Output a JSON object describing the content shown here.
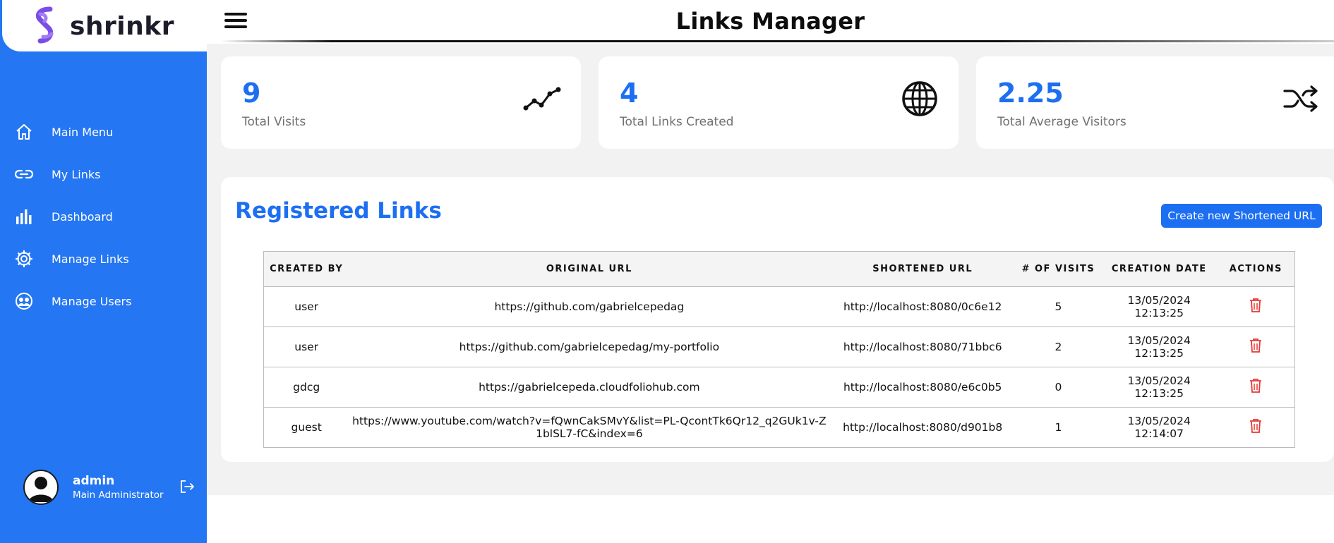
{
  "app": {
    "name": "shrinkr",
    "page_title": "Links Manager"
  },
  "colors": {
    "sidebar": "#2476f2",
    "accent": "#1d6ff2",
    "danger": "#e53935",
    "text_muted": "#707070"
  },
  "sidebar": {
    "items": [
      {
        "label": "Main Menu",
        "icon": "home-icon"
      },
      {
        "label": "My Links",
        "icon": "link-icon"
      },
      {
        "label": "Dashboard",
        "icon": "bar-chart-icon"
      },
      {
        "label": "Manage Links",
        "icon": "gear-icon"
      },
      {
        "label": "Manage Users",
        "icon": "users-icon"
      }
    ],
    "user": {
      "name": "admin",
      "role": "Main Administrator",
      "avatar_icon": "user-avatar-icon",
      "logout_icon": "logout-icon"
    }
  },
  "stats": [
    {
      "value": "9",
      "label": "Total Visits",
      "icon": "trend-line-icon"
    },
    {
      "value": "4",
      "label": "Total Links Created",
      "icon": "globe-icon"
    },
    {
      "value": "2.25",
      "label": "Total Average Visitors",
      "icon": "shuffle-icon"
    }
  ],
  "links_panel": {
    "title": "Registered Links",
    "create_button": "Create new Shortened URL",
    "columns": [
      "CREATED BY",
      "ORIGINAL URL",
      "SHORTENED URL",
      "# OF VISITS",
      "CREATION DATE",
      "ACTIONS"
    ],
    "rows": [
      {
        "created_by": "user",
        "original_url": "https://github.com/gabrielcepedag",
        "short_url": "http://localhost:8080/0c6e12",
        "visits": "5",
        "date": "13/05/2024",
        "time": "12:13:25"
      },
      {
        "created_by": "user",
        "original_url": "https://github.com/gabrielcepedag/my-portfolio",
        "short_url": "http://localhost:8080/71bbc6",
        "visits": "2",
        "date": "13/05/2024",
        "time": "12:13:25"
      },
      {
        "created_by": "gdcg",
        "original_url": "https://gabrielcepeda.cloudfoliohub.com",
        "short_url": "http://localhost:8080/e6c0b5",
        "visits": "0",
        "date": "13/05/2024",
        "time": "12:13:25"
      },
      {
        "created_by": "guest",
        "original_url": "https://www.youtube.com/watch?v=fQwnCakSMvY&list=PL-QcontTk6Qr12_q2GUk1v-Z1blSL7-fC&index=6",
        "short_url": "http://localhost:8080/d901b8",
        "visits": "1",
        "date": "13/05/2024",
        "time": "12:14:07"
      }
    ]
  }
}
